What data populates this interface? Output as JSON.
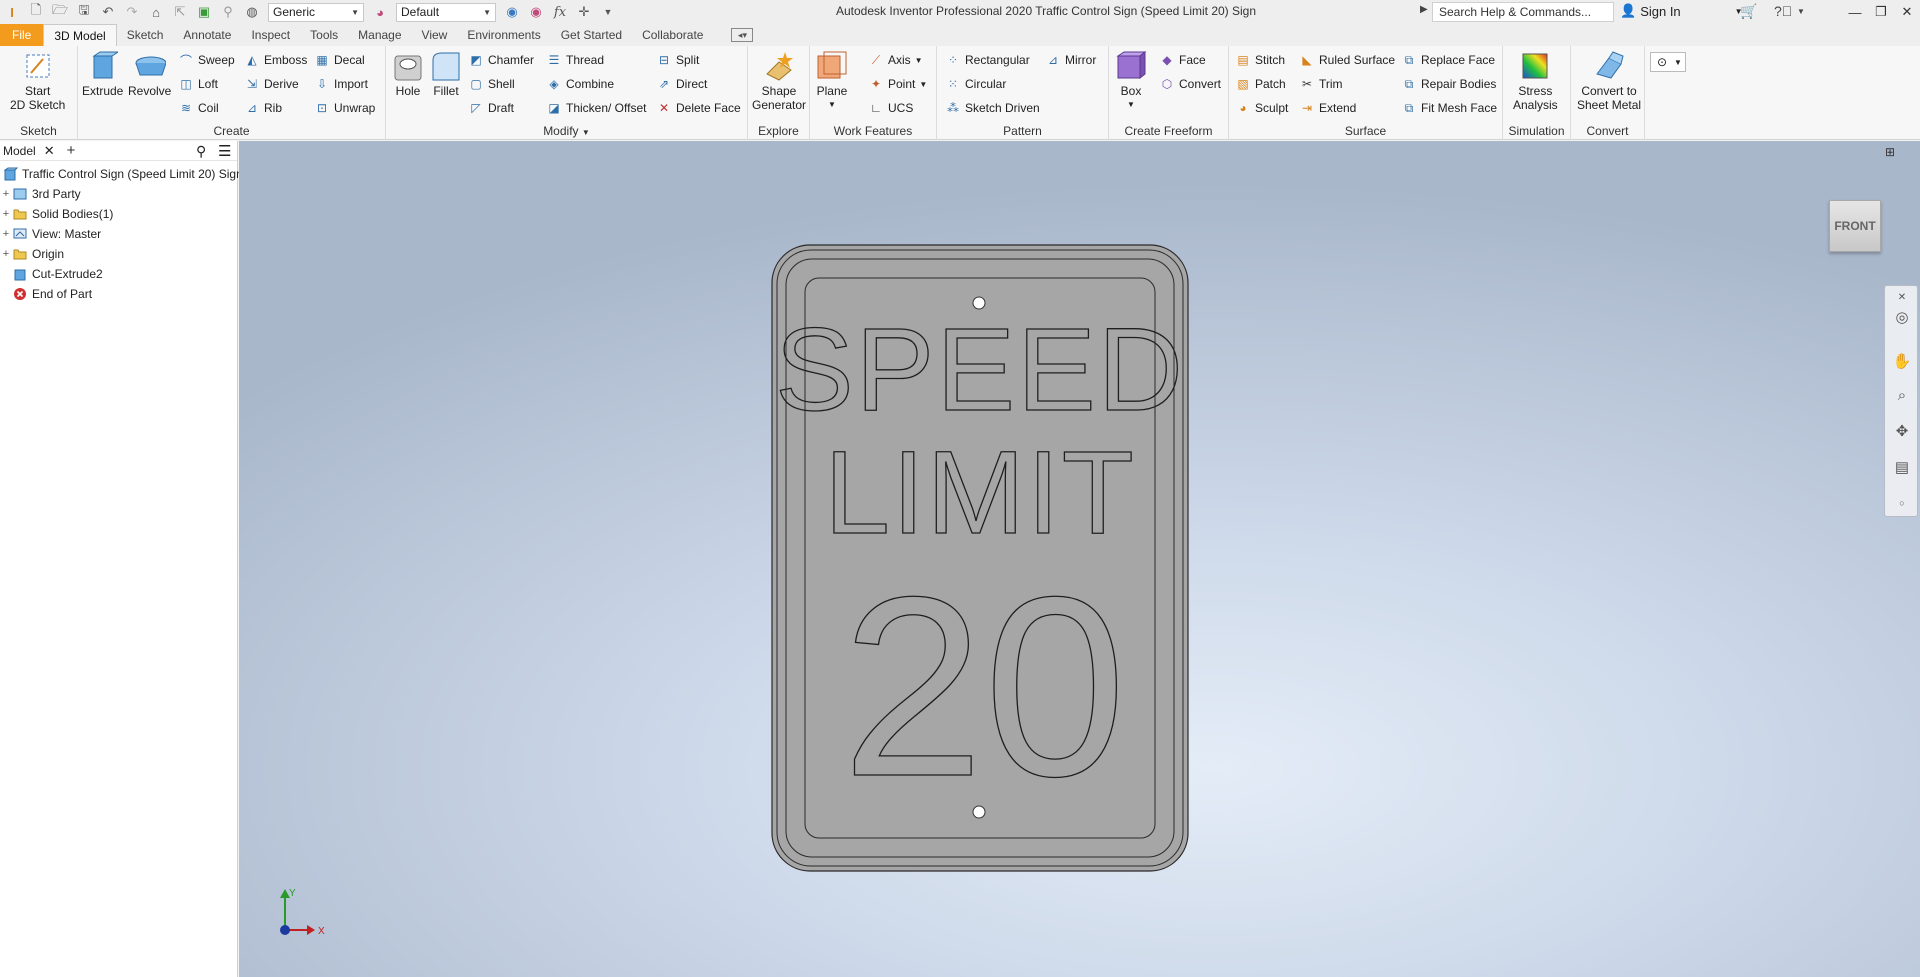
{
  "titlebar": {
    "app_title": "Autodesk Inventor Professional 2020   Traffic Control Sign (Speed Limit 20) Sign",
    "material_combo": "Generic",
    "appearance_combo": "Default",
    "fx_label": "fx",
    "search_placeholder": "Search Help & Commands...",
    "sign_in": "Sign In"
  },
  "tabs": {
    "file": "File",
    "items": [
      "3D Model",
      "Sketch",
      "Annotate",
      "Inspect",
      "Tools",
      "Manage",
      "View",
      "Environments",
      "Get Started",
      "Collaborate"
    ]
  },
  "ribbon": {
    "sketch": {
      "title": "Sketch",
      "start": "Start",
      "start2": "2D Sketch"
    },
    "create": {
      "title": "Create",
      "extrude": "Extrude",
      "revolve": "Revolve",
      "sweep": "Sweep",
      "loft": "Loft",
      "coil": "Coil",
      "emboss": "Emboss",
      "derive": "Derive",
      "rib": "Rib",
      "decal": "Decal",
      "import": "Import",
      "unwrap": "Unwrap"
    },
    "modify": {
      "title": "Modify",
      "hole": "Hole",
      "fillet": "Fillet",
      "chamfer": "Chamfer",
      "shell": "Shell",
      "draft": "Draft",
      "thread": "Thread",
      "combine": "Combine",
      "thicken": "Thicken/ Offset",
      "split": "Split",
      "direct": "Direct",
      "delete_face": "Delete Face"
    },
    "explore": {
      "title": "Explore",
      "shape": "Shape",
      "generator": "Generator"
    },
    "work_features": {
      "title": "Work Features",
      "plane": "Plane",
      "axis": "Axis",
      "point": "Point",
      "ucs": "UCS"
    },
    "pattern": {
      "title": "Pattern",
      "rectangular": "Rectangular",
      "circular": "Circular",
      "sketch_driven": "Sketch Driven",
      "mirror": "Mirror"
    },
    "freeform": {
      "title": "Create Freeform",
      "box": "Box",
      "face": "Face",
      "convert": "Convert"
    },
    "surface": {
      "title": "Surface",
      "stitch": "Stitch",
      "patch": "Patch",
      "sculpt": "Sculpt",
      "ruled": "Ruled Surface",
      "trim": "Trim",
      "extend": "Extend",
      "replace": "Replace Face",
      "repair": "Repair Bodies",
      "fit_mesh": "Fit Mesh Face"
    },
    "simulation": {
      "title": "Simulation",
      "stress": "Stress",
      "analysis": "Analysis"
    },
    "convert": {
      "title": "Convert",
      "to": "Convert to",
      "sheet": "Sheet Metal"
    }
  },
  "browser": {
    "tab": "Model",
    "items": [
      {
        "label": "Traffic Control Sign (Speed Limit 20) Sign",
        "icon": "part-icon"
      },
      {
        "label": "3rd Party",
        "icon": "third-party-icon"
      },
      {
        "label": "Solid Bodies(1)",
        "icon": "folder-icon"
      },
      {
        "label": "View: Master",
        "icon": "view-icon"
      },
      {
        "label": "Origin",
        "icon": "folder-icon"
      },
      {
        "label": "Cut-Extrude2",
        "icon": "extrude-icon"
      },
      {
        "label": "End of Part",
        "icon": "end-of-part-icon"
      }
    ]
  },
  "viewport": {
    "viewcube": "FRONT",
    "sign_line1": "SPEED",
    "sign_line2": "LIMIT",
    "sign_number": "20",
    "axis_y": "Y",
    "axis_x": "X"
  },
  "colors": {
    "file_tab": "#f29b1d",
    "sign_face": "#a6a6a6",
    "sign_outline": "#2a2a2a"
  }
}
